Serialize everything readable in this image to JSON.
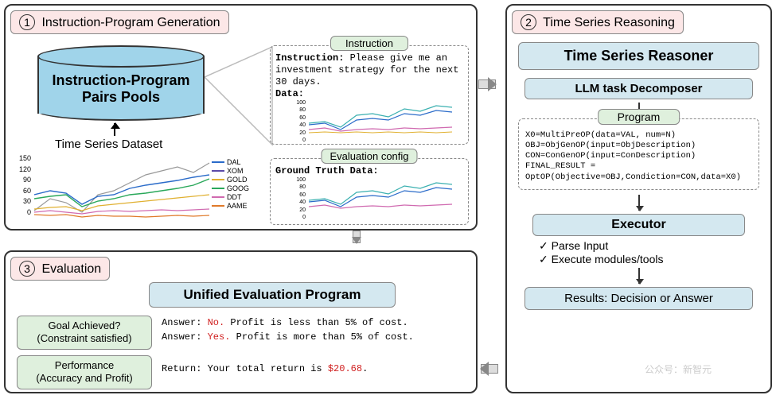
{
  "panel1": {
    "title": "Instruction-Program Generation",
    "num": "1",
    "cylinder_line1": "Instruction-Program",
    "cylinder_line2": "Pairs Pools",
    "dataset_label": "Time Series Dataset",
    "instruction_box_title": "Instruction",
    "instruction_label": "Instruction:",
    "instruction_text": "Please give me an investment strategy for the next 30 days.",
    "data_label": "Data:",
    "eval_config_title": "Evaluation config",
    "ground_truth_label": "Ground Truth Data:"
  },
  "panel2": {
    "title": "Time Series Reasoning",
    "num": "2",
    "reasoner_title": "Time Series Reasoner",
    "decomposer_title": "LLM task Decomposer",
    "program_title": "Program",
    "program_line1": "X0=MultiPreOP(data=VAL, num=N)",
    "program_line2": "OBJ=ObjGenOP(input=ObjDescription)",
    "program_line3": "CON=ConGenOP(input=ConDescription)",
    "program_line4": "FINAL_RESULT =",
    "program_line5": "OptOP(Objective=OBJ,Condiction=CON,data=X0)",
    "executor_title": "Executor",
    "exec_item1": "Parse Input",
    "exec_item2": "Execute modules/tools",
    "results_title": "Results: Decision or Answer"
  },
  "panel3": {
    "title": "Evaluation",
    "num": "3",
    "unified_title": "Unified Evaluation Program",
    "goal_line1": "Goal Achieved?",
    "goal_line2": "(Constraint satisfied)",
    "perf_line1": "Performance",
    "perf_line2": "(Accuracy and Profit)",
    "ans_prefix": "Answer: ",
    "ans1_val": "No.",
    "ans1_rest": " Profit is less than 5% of cost.",
    "ans2_val": "Yes.",
    "ans2_rest": " Profit is more than 5% of cost.",
    "return_prefix": "Return: Your total return is ",
    "return_val": "$20.68",
    "return_suffix": "."
  },
  "check": "✓",
  "watermark": "公众号：新智元",
  "chart_data": {
    "type": "line",
    "title": "Time Series Dataset",
    "ylim": [
      0,
      150
    ],
    "yticks": [
      0,
      30,
      60,
      90,
      120,
      150
    ],
    "series": [
      {
        "name": "DAL",
        "color": "#2a6bc9"
      },
      {
        "name": "XOM",
        "color": "#5b4aa8"
      },
      {
        "name": "GOLD",
        "color": "#e0b030"
      },
      {
        "name": "GOOG",
        "color": "#2aa85a"
      },
      {
        "name": "DDT",
        "color": "#d06ab0"
      },
      {
        "name": "AAME",
        "color": "#e07a2a"
      }
    ],
    "mini_chart_yticks": [
      0,
      20,
      40,
      60,
      80,
      100
    ]
  }
}
